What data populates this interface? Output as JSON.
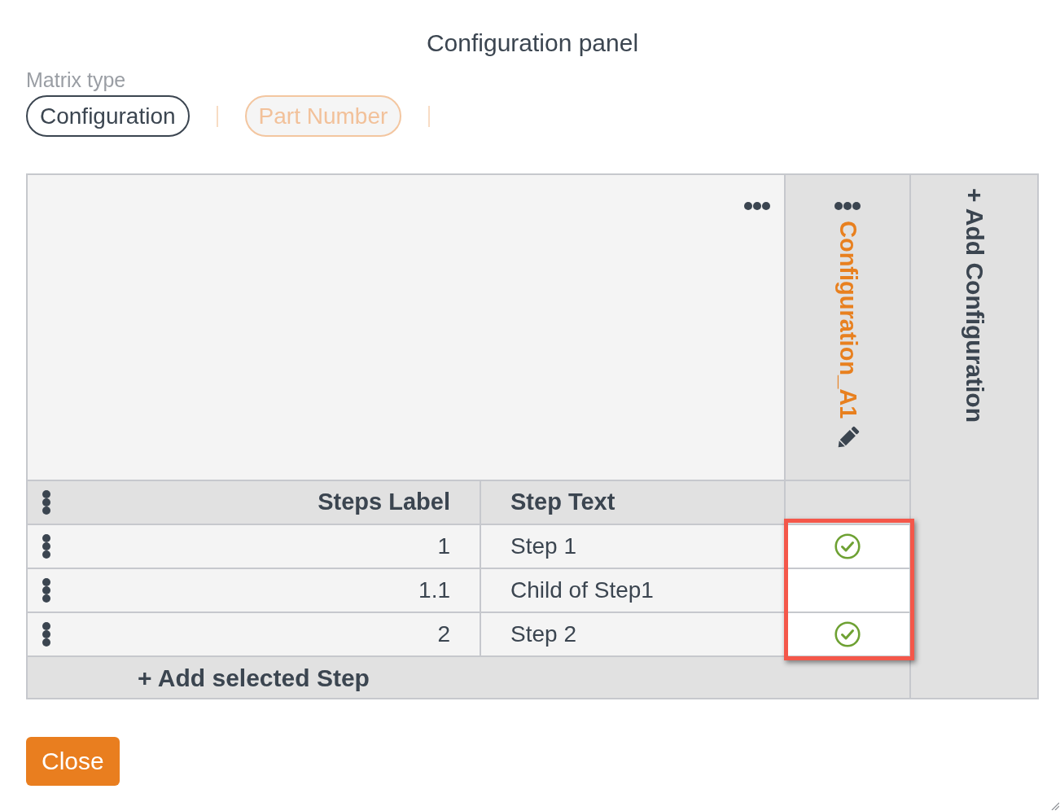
{
  "dialog": {
    "title": "Configuration panel"
  },
  "matrix_type": {
    "label": "Matrix type",
    "options": [
      {
        "label": "Configuration",
        "selected": true
      },
      {
        "label": "Part Number",
        "selected": false
      }
    ]
  },
  "matrix": {
    "columns": [
      {
        "label": "Steps Label"
      },
      {
        "label": "Step Text"
      }
    ],
    "configurations": [
      {
        "name": "Configuration_A1",
        "highlighted": true
      }
    ],
    "add_configuration": "+ Add Configuration",
    "rows": [
      {
        "label": "1",
        "text": "Step 1",
        "checks": [
          {
            "checked": true
          }
        ]
      },
      {
        "label": "1.1",
        "text": "Child of Step1",
        "checks": [
          {
            "checked": false
          }
        ]
      },
      {
        "label": "2",
        "text": "Step 2",
        "checks": [
          {
            "checked": true
          }
        ]
      }
    ],
    "add_step": "+ Add selected Step"
  },
  "buttons": [
    {
      "label": "Close"
    }
  ]
}
